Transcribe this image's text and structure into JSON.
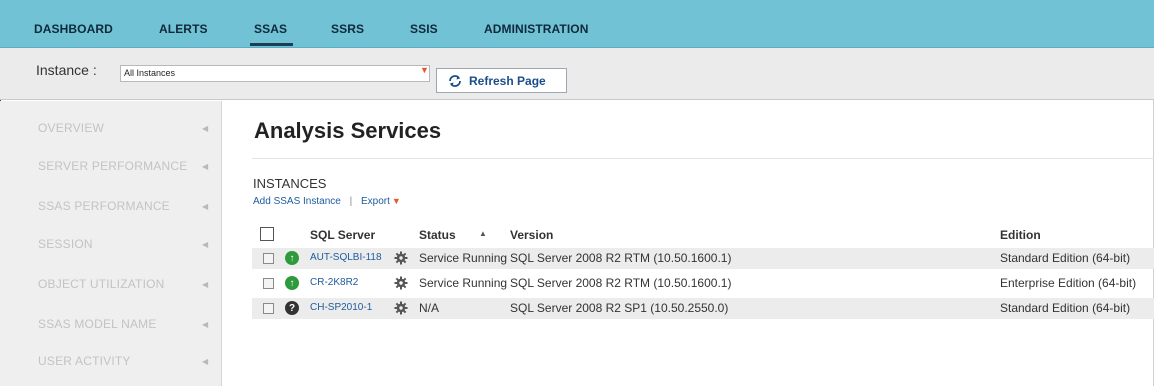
{
  "nav": {
    "items": [
      "DASHBOARD",
      "ALERTS",
      "SSAS",
      "SSRS",
      "SSIS",
      "ADMINISTRATION"
    ],
    "active": "SSAS"
  },
  "instance_bar": {
    "label": "Instance :",
    "selected": "All Instances",
    "refresh_label": "Refresh Page"
  },
  "sidebar": {
    "items": [
      "OVERVIEW",
      "SERVER PERFORMANCE",
      "SSAS PERFORMANCE",
      "SESSION",
      "OBJECT UTILIZATION",
      "SSAS MODEL NAME",
      "USER ACTIVITY"
    ]
  },
  "main": {
    "title": "Analysis Services",
    "section": "INSTANCES",
    "add_link": "Add SSAS Instance",
    "separator": "|",
    "export_link": "Export",
    "columns": [
      "SQL Server",
      "Status",
      "Version",
      "Edition"
    ],
    "rows": [
      {
        "server": "AUT-SQLBI-118",
        "status": "Service Running",
        "version": "SQL Server 2008 R2 RTM (10.50.1600.1)",
        "edition": "Standard Edition (64-bit)",
        "state": "up"
      },
      {
        "server": "CR-2K8R2",
        "status": "Service Running",
        "version": "SQL Server 2008 R2 RTM (10.50.1600.1)",
        "edition": "Enterprise Edition (64-bit)",
        "state": "up"
      },
      {
        "server": "CH-SP2010-1",
        "status": "N/A",
        "version": "SQL Server 2008 R2 SP1 (10.50.2550.0)",
        "edition": "Standard Edition (64-bit)",
        "state": "unknown"
      }
    ]
  },
  "colors": {
    "nav_bg": "#72c2d6",
    "link": "#1d5b9e",
    "accent": "#e8572a",
    "status_up": "#2e9a3c"
  }
}
